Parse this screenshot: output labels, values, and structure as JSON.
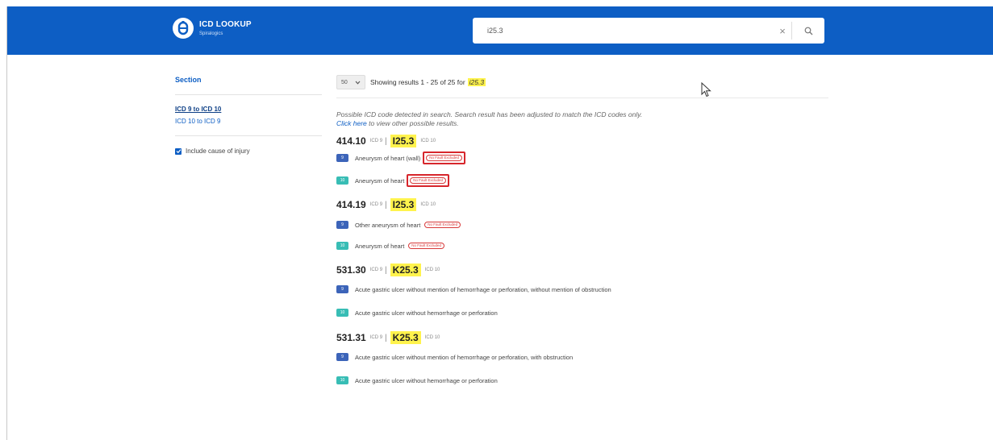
{
  "header": {
    "logo_title": "ICD LOOKUP",
    "logo_subtitle": "Spiralogics"
  },
  "search": {
    "value": "i25.3",
    "clear_glyph": "×"
  },
  "sidebar": {
    "section_title": "Section",
    "links": [
      "ICD 9 to ICD 10",
      "ICD 10 to ICD 9"
    ],
    "checkbox_label": "Include cause of injury",
    "checkbox_checked": true
  },
  "results": {
    "per_page": "50",
    "showing_text": "Showing results 1 - 25 of 25 for",
    "query": "i25.3",
    "notice_text": "Possible ICD code detected in search. Search result has been adjusted to match the ICD codes only.",
    "notice_link": "Click here",
    "notice_tail": "to view other possible results.",
    "icd9_label": "ICD 9",
    "icd10_label": "ICD 10",
    "icd9_badge": "9",
    "icd10_badge": "10",
    "pill_text": "No Fault Excluded",
    "groups": [
      {
        "icd9": "414.10",
        "icd10": "I25.3",
        "desc9": "Aneurysm of heart (wall)",
        "desc10": "Aneurysm of heart"
      },
      {
        "icd9": "414.19",
        "icd10": "I25.3",
        "desc9": "Other aneurysm of heart",
        "desc10": "Aneurysm of heart"
      },
      {
        "icd9": "531.30",
        "icd10": "K25.3",
        "desc9": "Acute gastric ulcer without mention of hemorrhage or perforation, without mention of obstruction",
        "desc10": "Acute gastric ulcer without hemorrhage or perforation"
      },
      {
        "icd9": "531.31",
        "icd10": "K25.3",
        "desc9": "Acute gastric ulcer without mention of hemorrhage or perforation, with obstruction",
        "desc10": "Acute gastric ulcer without hemorrhage or perforation"
      }
    ]
  },
  "colors": {
    "header_bg": "#0d5ec4",
    "highlight": "#fff34d",
    "icd9_badge": "#3c64b9",
    "icd10_badge": "#38bdb5",
    "pill": "#d83a3a",
    "callout_box": "#d7262c"
  }
}
